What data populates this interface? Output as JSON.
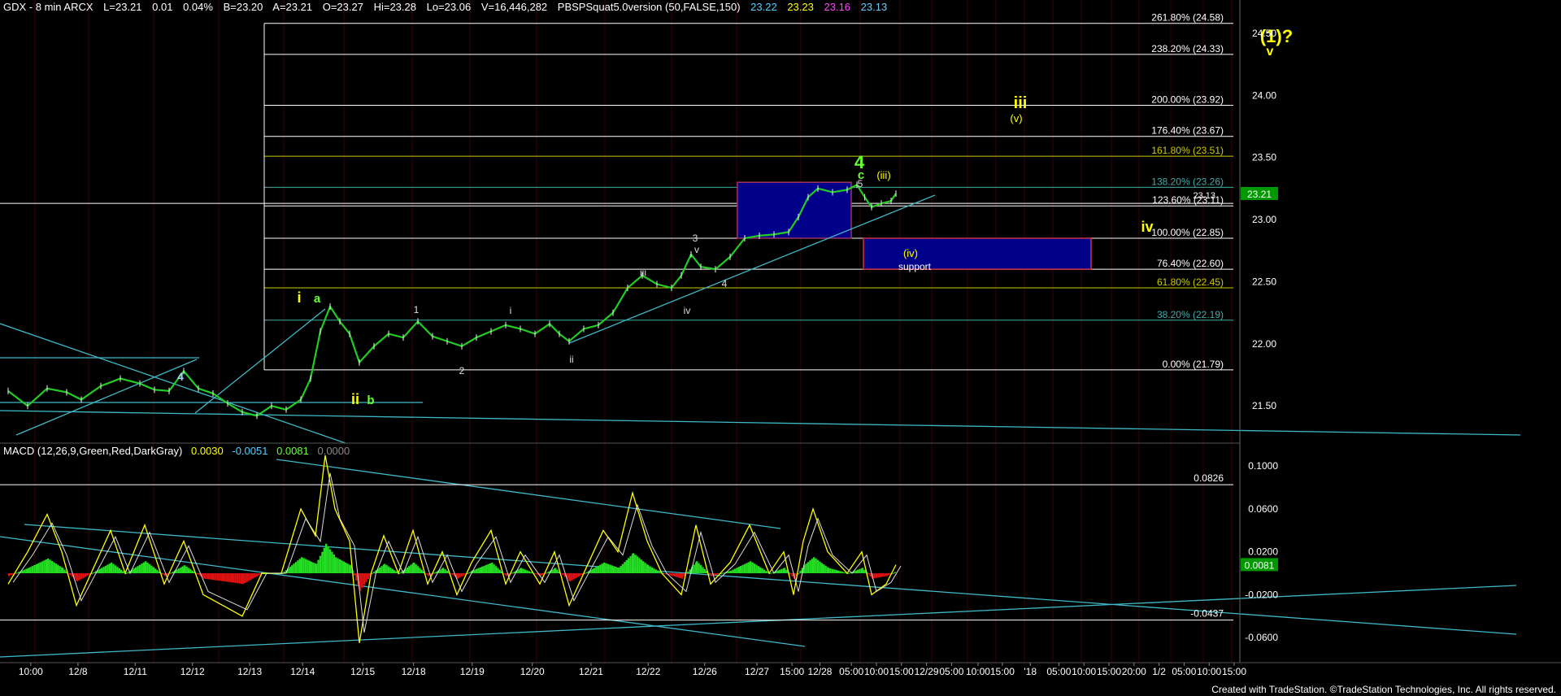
{
  "header": {
    "symbol": "GDX - 8 min  ARCX",
    "last": "L=23.21",
    "change": "0.01",
    "pct": "0.04%",
    "bid": "B=23.20",
    "ask": "A=23.21",
    "open": "O=23.27",
    "high": "Hi=23.28",
    "low": "Lo=23.06",
    "volume": "V=16,446,282",
    "study": "PBSPSquat5.0version (50,FALSE,150)",
    "v1": "23.22",
    "v2": "23.23",
    "v3": "23.16",
    "v4": "23.13",
    "c1": "#4fd1ff",
    "c2": "#ffff00",
    "c3": "#ff44ff",
    "c4": "#66ccff"
  },
  "macd_header": {
    "name": "MACD (12,26,9,Green,Red,DarkGray)",
    "v1": "0.0030",
    "v2": "-0.0051",
    "v3": "0.0081",
    "v4": "0.0000"
  },
  "footer": "Created with TradeStation. ©TradeStation Technologies, Inc. All rights reserved.",
  "chart_data": {
    "type": "line",
    "price_axis": {
      "ylim": [
        21.2,
        24.65
      ],
      "ticks": [
        "24.50",
        "24.00",
        "23.50",
        "23.00",
        "22.50",
        "22.00",
        "21.50"
      ],
      "last_label": "23.21",
      "side_label": "23.13"
    },
    "x_labels": [
      "10:00",
      "12/8",
      "12/11",
      "12/12",
      "12/13",
      "12/14",
      "12/15",
      "12/18",
      "12/19",
      "12/20",
      "12/21",
      "12/22",
      "12/26",
      "12/27",
      "15:00",
      "12/28",
      "05:00",
      "10:00",
      "15:00",
      "12/29",
      "05:00",
      "10:00",
      "15:00",
      "'18",
      "05:00",
      "10:00",
      "15:00",
      "20:00",
      "1/2",
      "05:00",
      "10:00",
      "15:00"
    ],
    "fib_levels": [
      {
        "label": "261.80% (24.58)",
        "value": 24.58,
        "color": "#ffffff"
      },
      {
        "label": "238.20% (24.33)",
        "value": 24.33,
        "color": "#ffffff"
      },
      {
        "label": "200.00% (23.92)",
        "value": 23.92,
        "color": "#ffffff"
      },
      {
        "label": "176.40% (23.67)",
        "value": 23.67,
        "color": "#ffffff"
      },
      {
        "label": "161.80% (23.51)",
        "value": 23.51,
        "color": "#cccc00"
      },
      {
        "label": "138.20% (23.26)",
        "value": 23.26,
        "color": "#44aaaa"
      },
      {
        "label": "123.60% (23.11)",
        "value": 23.11,
        "color": "#ffffff"
      },
      {
        "label": "100.00% (22.85)",
        "value": 22.85,
        "color": "#ffffff"
      },
      {
        "label": "76.40% (22.60)",
        "value": 22.6,
        "color": "#ffffff"
      },
      {
        "label": "61.80% (22.45)",
        "value": 22.45,
        "color": "#cccc00"
      },
      {
        "label": "38.20% (22.19)",
        "value": 22.19,
        "color": "#44aaaa"
      },
      {
        "label": "0.00% (21.79)",
        "value": 21.79,
        "color": "#ffffff"
      }
    ],
    "price_series": [
      {
        "x": 0,
        "y": 21.62
      },
      {
        "x": 20,
        "y": 21.5
      },
      {
        "x": 40,
        "y": 21.64
      },
      {
        "x": 60,
        "y": 21.61
      },
      {
        "x": 75,
        "y": 21.55
      },
      {
        "x": 95,
        "y": 21.66
      },
      {
        "x": 115,
        "y": 21.72
      },
      {
        "x": 135,
        "y": 21.68
      },
      {
        "x": 150,
        "y": 21.63
      },
      {
        "x": 165,
        "y": 21.62
      },
      {
        "x": 180,
        "y": 21.78
      },
      {
        "x": 195,
        "y": 21.64
      },
      {
        "x": 210,
        "y": 21.6
      },
      {
        "x": 225,
        "y": 21.52
      },
      {
        "x": 240,
        "y": 21.45
      },
      {
        "x": 255,
        "y": 21.42
      },
      {
        "x": 270,
        "y": 21.5
      },
      {
        "x": 285,
        "y": 21.47
      },
      {
        "x": 300,
        "y": 21.55
      },
      {
        "x": 310,
        "y": 21.72
      },
      {
        "x": 320,
        "y": 22.1
      },
      {
        "x": 330,
        "y": 22.3
      },
      {
        "x": 340,
        "y": 22.18
      },
      {
        "x": 350,
        "y": 22.08
      },
      {
        "x": 360,
        "y": 21.85
      },
      {
        "x": 375,
        "y": 21.98
      },
      {
        "x": 390,
        "y": 22.08
      },
      {
        "x": 405,
        "y": 22.05
      },
      {
        "x": 420,
        "y": 22.18
      },
      {
        "x": 435,
        "y": 22.06
      },
      {
        "x": 450,
        "y": 22.02
      },
      {
        "x": 465,
        "y": 21.98
      },
      {
        "x": 480,
        "y": 22.05
      },
      {
        "x": 495,
        "y": 22.1
      },
      {
        "x": 510,
        "y": 22.15
      },
      {
        "x": 525,
        "y": 22.12
      },
      {
        "x": 540,
        "y": 22.08
      },
      {
        "x": 555,
        "y": 22.16
      },
      {
        "x": 565,
        "y": 22.08
      },
      {
        "x": 575,
        "y": 22.02
      },
      {
        "x": 590,
        "y": 22.12
      },
      {
        "x": 605,
        "y": 22.15
      },
      {
        "x": 620,
        "y": 22.25
      },
      {
        "x": 635,
        "y": 22.45
      },
      {
        "x": 650,
        "y": 22.55
      },
      {
        "x": 665,
        "y": 22.48
      },
      {
        "x": 680,
        "y": 22.45
      },
      {
        "x": 690,
        "y": 22.55
      },
      {
        "x": 700,
        "y": 22.72
      },
      {
        "x": 710,
        "y": 22.62
      },
      {
        "x": 725,
        "y": 22.6
      },
      {
        "x": 740,
        "y": 22.7
      },
      {
        "x": 755,
        "y": 22.85
      },
      {
        "x": 770,
        "y": 22.87
      },
      {
        "x": 785,
        "y": 22.88
      },
      {
        "x": 800,
        "y": 22.9
      },
      {
        "x": 810,
        "y": 23.02
      },
      {
        "x": 820,
        "y": 23.18
      },
      {
        "x": 830,
        "y": 23.25
      },
      {
        "x": 845,
        "y": 23.22
      },
      {
        "x": 860,
        "y": 23.24
      },
      {
        "x": 870,
        "y": 23.28
      },
      {
        "x": 878,
        "y": 23.18
      },
      {
        "x": 885,
        "y": 23.1
      },
      {
        "x": 895,
        "y": 23.13
      },
      {
        "x": 905,
        "y": 23.15
      },
      {
        "x": 910,
        "y": 23.21
      }
    ],
    "wave_labels": [
      {
        "text": "(1)?",
        "color": "#ffff00"
      },
      {
        "text": "v",
        "color": "#ffff00"
      },
      {
        "text": "iii",
        "color": "#ffff00"
      },
      {
        "text": "(v)",
        "color": "#ffff00"
      },
      {
        "text": "4",
        "color": "#66ff33"
      },
      {
        "text": "c",
        "color": "#66ff33"
      },
      {
        "text": "5",
        "color": "#dddddd"
      },
      {
        "text": "(iii)",
        "color": "#ffff00"
      },
      {
        "text": "(iv)",
        "color": "#ffff00"
      },
      {
        "text": "support",
        "color": "#ffffff"
      },
      {
        "text": "iv",
        "color": "#ffff00"
      },
      {
        "text": "3",
        "color": "#dddddd"
      },
      {
        "text": "v",
        "color": "#dddddd"
      },
      {
        "text": "iii",
        "color": "#dddddd"
      },
      {
        "text": "4",
        "color": "#dddddd"
      },
      {
        "text": "iv",
        "color": "#dddddd"
      },
      {
        "text": "i",
        "color": "#dddddd"
      },
      {
        "text": "ii",
        "color": "#dddddd"
      },
      {
        "text": "1",
        "color": "#dddddd"
      },
      {
        "text": "2",
        "color": "#dddddd"
      },
      {
        "text": "i",
        "color": "#ffff00"
      },
      {
        "text": "a",
        "color": "#66ff33"
      },
      {
        "text": "ii",
        "color": "#ffff00"
      },
      {
        "text": "b",
        "color": "#66ff33"
      },
      {
        "text": "4",
        "color": "#aaccff"
      }
    ],
    "macd": {
      "ylim": [
        -0.072,
        0.11
      ],
      "ticks": [
        "0.1000",
        "0.0600",
        "0.0200",
        "-0.0200",
        "-0.0600"
      ],
      "levels": [
        {
          "label": "0.0826",
          "value": 0.0826
        },
        {
          "label": "-0.0437",
          "value": -0.0437
        }
      ],
      "last_label": "0.0081",
      "line": [
        {
          "x": 0,
          "y": -0.01
        },
        {
          "x": 20,
          "y": 0.02
        },
        {
          "x": 40,
          "y": 0.055
        },
        {
          "x": 55,
          "y": 0.02
        },
        {
          "x": 70,
          "y": -0.03
        },
        {
          "x": 85,
          "y": 0.0
        },
        {
          "x": 105,
          "y": 0.04
        },
        {
          "x": 120,
          "y": 0.0
        },
        {
          "x": 140,
          "y": 0.045
        },
        {
          "x": 160,
          "y": -0.01
        },
        {
          "x": 180,
          "y": 0.03
        },
        {
          "x": 200,
          "y": -0.02
        },
        {
          "x": 220,
          "y": -0.03
        },
        {
          "x": 240,
          "y": -0.04
        },
        {
          "x": 260,
          "y": 0.0
        },
        {
          "x": 280,
          "y": 0.0
        },
        {
          "x": 300,
          "y": 0.06
        },
        {
          "x": 315,
          "y": 0.035
        },
        {
          "x": 325,
          "y": 0.11
        },
        {
          "x": 335,
          "y": 0.06
        },
        {
          "x": 350,
          "y": 0.03
        },
        {
          "x": 360,
          "y": -0.065
        },
        {
          "x": 372,
          "y": 0.0
        },
        {
          "x": 385,
          "y": 0.035
        },
        {
          "x": 400,
          "y": 0.0
        },
        {
          "x": 415,
          "y": 0.04
        },
        {
          "x": 430,
          "y": -0.01
        },
        {
          "x": 445,
          "y": 0.02
        },
        {
          "x": 460,
          "y": -0.02
        },
        {
          "x": 475,
          "y": 0.01
        },
        {
          "x": 495,
          "y": 0.04
        },
        {
          "x": 510,
          "y": -0.01
        },
        {
          "x": 525,
          "y": 0.02
        },
        {
          "x": 545,
          "y": -0.01
        },
        {
          "x": 560,
          "y": 0.02
        },
        {
          "x": 575,
          "y": -0.03
        },
        {
          "x": 590,
          "y": 0.0
        },
        {
          "x": 610,
          "y": 0.04
        },
        {
          "x": 625,
          "y": 0.02
        },
        {
          "x": 640,
          "y": 0.075
        },
        {
          "x": 655,
          "y": 0.03
        },
        {
          "x": 670,
          "y": 0.0
        },
        {
          "x": 690,
          "y": -0.02
        },
        {
          "x": 705,
          "y": 0.045
        },
        {
          "x": 720,
          "y": -0.01
        },
        {
          "x": 740,
          "y": 0.01
        },
        {
          "x": 760,
          "y": 0.045
        },
        {
          "x": 780,
          "y": 0.0
        },
        {
          "x": 795,
          "y": 0.02
        },
        {
          "x": 805,
          "y": -0.02
        },
        {
          "x": 815,
          "y": 0.03
        },
        {
          "x": 825,
          "y": 0.06
        },
        {
          "x": 840,
          "y": 0.02
        },
        {
          "x": 860,
          "y": 0.0
        },
        {
          "x": 875,
          "y": 0.02
        },
        {
          "x": 885,
          "y": -0.02
        },
        {
          "x": 900,
          "y": -0.01
        },
        {
          "x": 910,
          "y": 0.008
        }
      ]
    }
  }
}
